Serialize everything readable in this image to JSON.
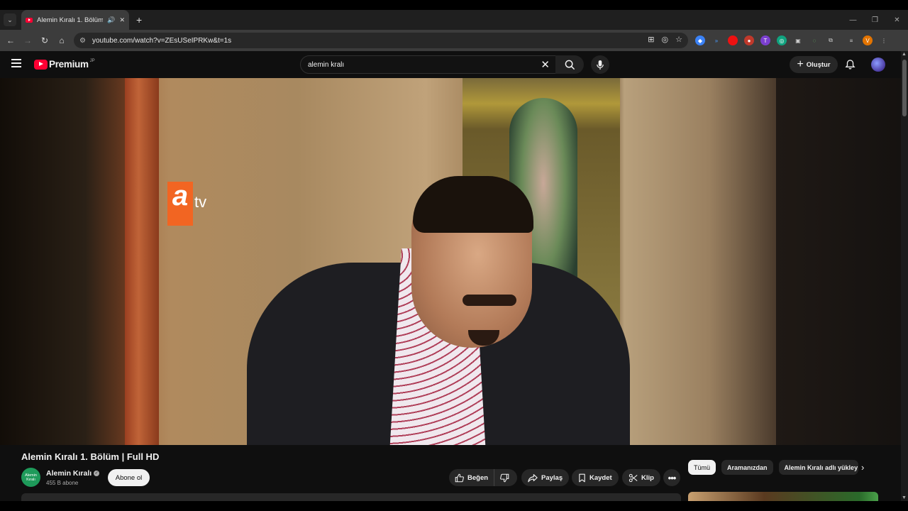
{
  "browser": {
    "tab_title": "Alemin Kıralı 1. Bölüm | Full HD",
    "url": "youtube.com/watch?v=ZEsUSeIPRKw&t=1s"
  },
  "header": {
    "logo_text": "Premium",
    "logo_region": "JP",
    "search_value": "alemin kralı",
    "create_label": "Oluştur"
  },
  "video": {
    "title": "Alemin Kıralı 1. Bölüm | Full HD",
    "watermark_text": "atv"
  },
  "channel": {
    "avatar_text": "Alemin Kıralı",
    "name": "Alemin Kıralı",
    "subscribers": "455 B abone",
    "subscribe_label": "Abone ol"
  },
  "actions": {
    "like": "Beğen",
    "share": "Paylaş",
    "save": "Kaydet",
    "clip": "Klip"
  },
  "chips": [
    "Tümü",
    "Aramanızdan",
    "Alemin Kıralı adlı yükley"
  ],
  "colors": {
    "brand_red": "#ff0033",
    "background": "#0f0f0f",
    "atv_orange": "#f26522"
  }
}
